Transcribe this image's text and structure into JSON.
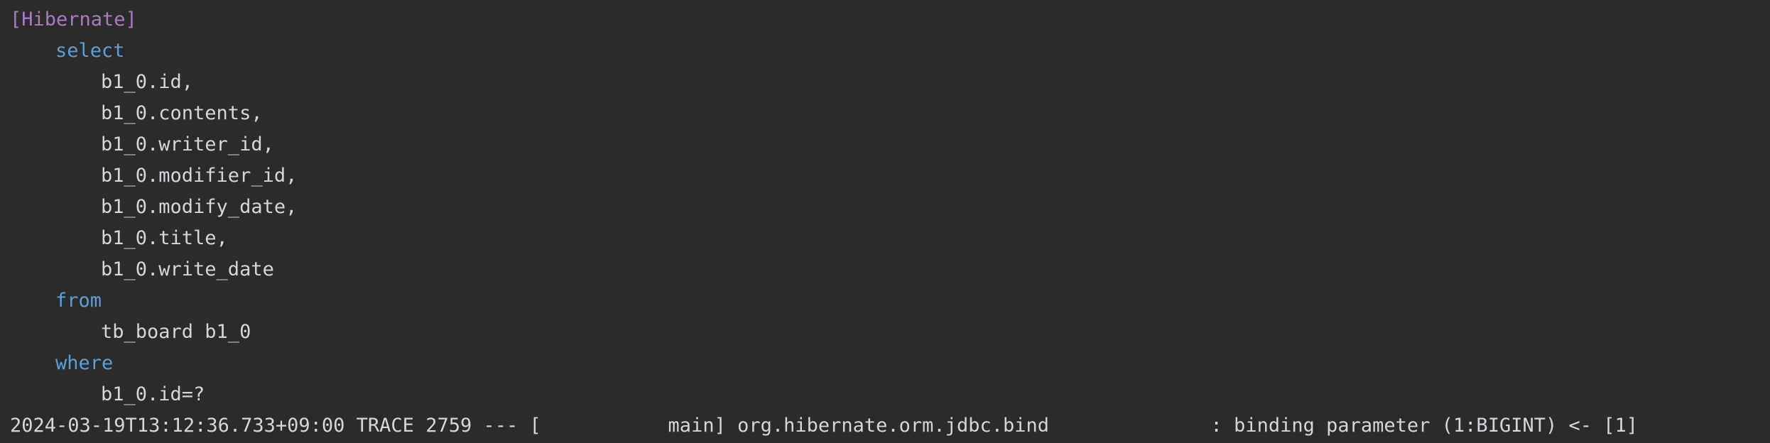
{
  "console": {
    "tag": "[Hibernate]",
    "keyword_select": "select",
    "columns": [
      "b1_0.id,",
      "b1_0.contents,",
      "b1_0.writer_id,",
      "b1_0.modifier_id,",
      "b1_0.modify_date,",
      "b1_0.title,",
      "b1_0.write_date"
    ],
    "keyword_from": "from",
    "table": "tb_board b1_0",
    "keyword_where": "where",
    "condition": "b1_0.id=?",
    "log_line": "2024-03-19T13:12:36.733+09:00 TRACE 2759 --- [           main] org.hibernate.orm.jdbc.bind              : binding parameter (1:BIGINT) <- [1]"
  },
  "colors": {
    "background": "#2b2b2b",
    "text": "#d4d6db",
    "tag": "#a97bbf",
    "keyword": "#5c9fd6"
  }
}
